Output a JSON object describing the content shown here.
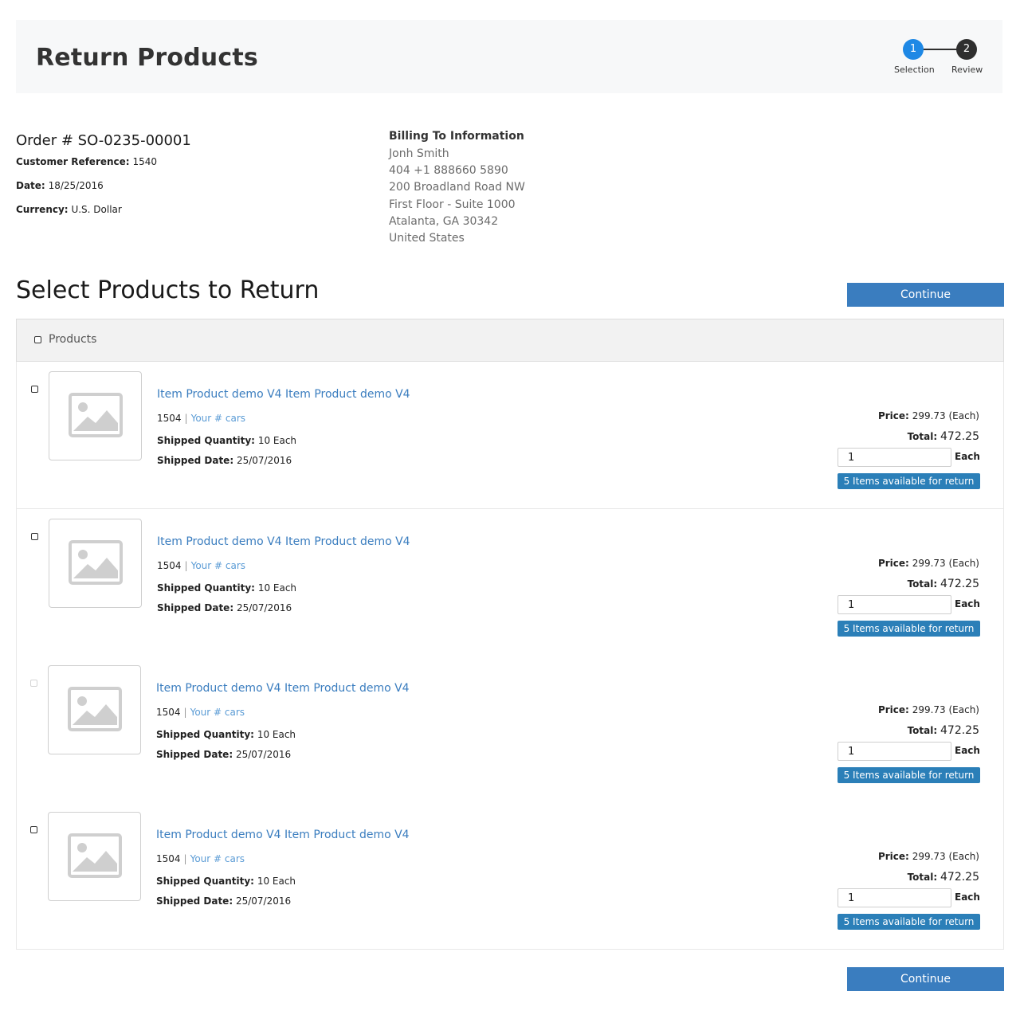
{
  "header": {
    "title": "Return Products",
    "steps": [
      {
        "number": "1",
        "label": "Selection"
      },
      {
        "number": "2",
        "label": "Review"
      }
    ]
  },
  "order": {
    "number": "Order # SO-0235-00001",
    "customer_reference_label": "Customer Reference:",
    "customer_reference": "1540",
    "date_label": "Date:",
    "date": "18/25/2016",
    "currency_label": "Currency:",
    "currency": "U.S. Dollar"
  },
  "billing": {
    "title": "Billing To Information",
    "lines": [
      "Jonh Smith",
      "404 +1 888660 5890",
      "200 Broadland Road NW",
      "First Floor - Suite 1000",
      "Atalanta, GA 30342",
      "United States"
    ]
  },
  "section": {
    "title": "Select Products to Return",
    "continue_label": "Continue"
  },
  "products": {
    "header_label": "Products",
    "items": [
      {
        "name": "Item Product demo V4 Item Product demo V4",
        "code": "1504",
        "separator": "|",
        "ref": "Your # cars",
        "shipped_qty_label": "Shipped Quantity:",
        "shipped_qty": "10 Each",
        "shipped_date_label": "Shipped Date:",
        "shipped_date": "25/07/2016",
        "price_label": "Price:",
        "price": "299.73 (Each)",
        "total_label": "Total:",
        "total": "472.25",
        "qty_value": "1",
        "unit": "Each",
        "availability": "5 Items available for return",
        "disabled": false
      },
      {
        "name": "Item Product demo V4 Item Product demo V4",
        "code": "1504",
        "separator": "|",
        "ref": "Your # cars",
        "shipped_qty_label": "Shipped Quantity:",
        "shipped_qty": "10 Each",
        "shipped_date_label": "Shipped Date:",
        "shipped_date": "25/07/2016",
        "price_label": "Price:",
        "price": "299.73 (Each)",
        "total_label": "Total:",
        "total": "472.25",
        "qty_value": "1",
        "unit": "Each",
        "availability": "5 Items available for return",
        "disabled": false
      },
      {
        "name": "Item Product demo V4 Item Product demo V4",
        "code": "1504",
        "separator": "|",
        "ref": "Your # cars",
        "shipped_qty_label": "Shipped Quantity:",
        "shipped_qty": "10 Each",
        "shipped_date_label": "Shipped Date:",
        "shipped_date": "25/07/2016",
        "price_label": "Price:",
        "price": "299.73 (Each)",
        "total_label": "Total:",
        "total": "472.25",
        "qty_value": "1",
        "unit": "Each",
        "availability": "5 Items available for return",
        "disabled": true
      },
      {
        "name": "Item Product demo V4 Item Product demo V4",
        "code": "1504",
        "separator": "|",
        "ref": "Your # cars",
        "shipped_qty_label": "Shipped Quantity:",
        "shipped_qty": "10 Each",
        "shipped_date_label": "Shipped Date:",
        "shipped_date": "25/07/2016",
        "price_label": "Price:",
        "price": "299.73 (Each)",
        "total_label": "Total:",
        "total": "472.25",
        "qty_value": "1",
        "unit": "Each",
        "availability": "5 Items available for return",
        "disabled": false
      }
    ]
  },
  "colors": {
    "step_active": "#1e88e5",
    "step_inactive": "#2f2f2f",
    "link": "#3a7dbf",
    "button": "#3a7dbf",
    "badge": "#2b7fb8"
  }
}
